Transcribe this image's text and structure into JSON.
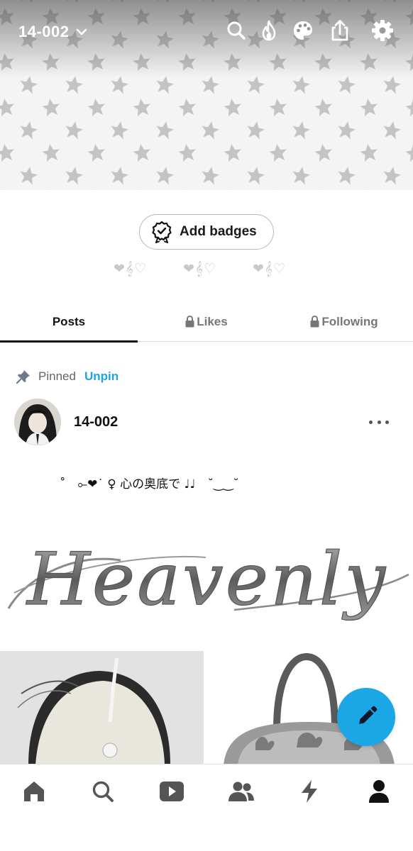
{
  "header": {
    "blog_name": "14-002",
    "icons": [
      "chevron-down-icon",
      "search-icon",
      "flame-icon",
      "palette-icon",
      "share-icon",
      "gear-icon"
    ]
  },
  "badges": {
    "add_label": "Add badges",
    "decorations": [
      "❤︎𝄞♡",
      "❤︎𝄞♡",
      "❤︎𝄞♡"
    ]
  },
  "tabs": [
    {
      "label": "Posts",
      "locked": false,
      "active": true
    },
    {
      "label": "Likes",
      "locked": true,
      "active": false
    },
    {
      "label": "Following",
      "locked": true,
      "active": false
    }
  ],
  "post": {
    "pinned_label": "Pinned",
    "unpin_label": "Unpin",
    "author": "14-002",
    "text": "˚　⟜❤︎˙ ♀ 心の奥底で ♩♩　˘‿‿˘",
    "image_text": "Heavenly"
  },
  "colors": {
    "accent": "#1ea5dd",
    "fab": "#1ba6e6",
    "star": "#c4c4c4",
    "nav_icon": "#555555"
  },
  "nav": [
    "home-icon",
    "search-icon",
    "video-icon",
    "people-icon",
    "lightning-icon",
    "account-icon"
  ]
}
